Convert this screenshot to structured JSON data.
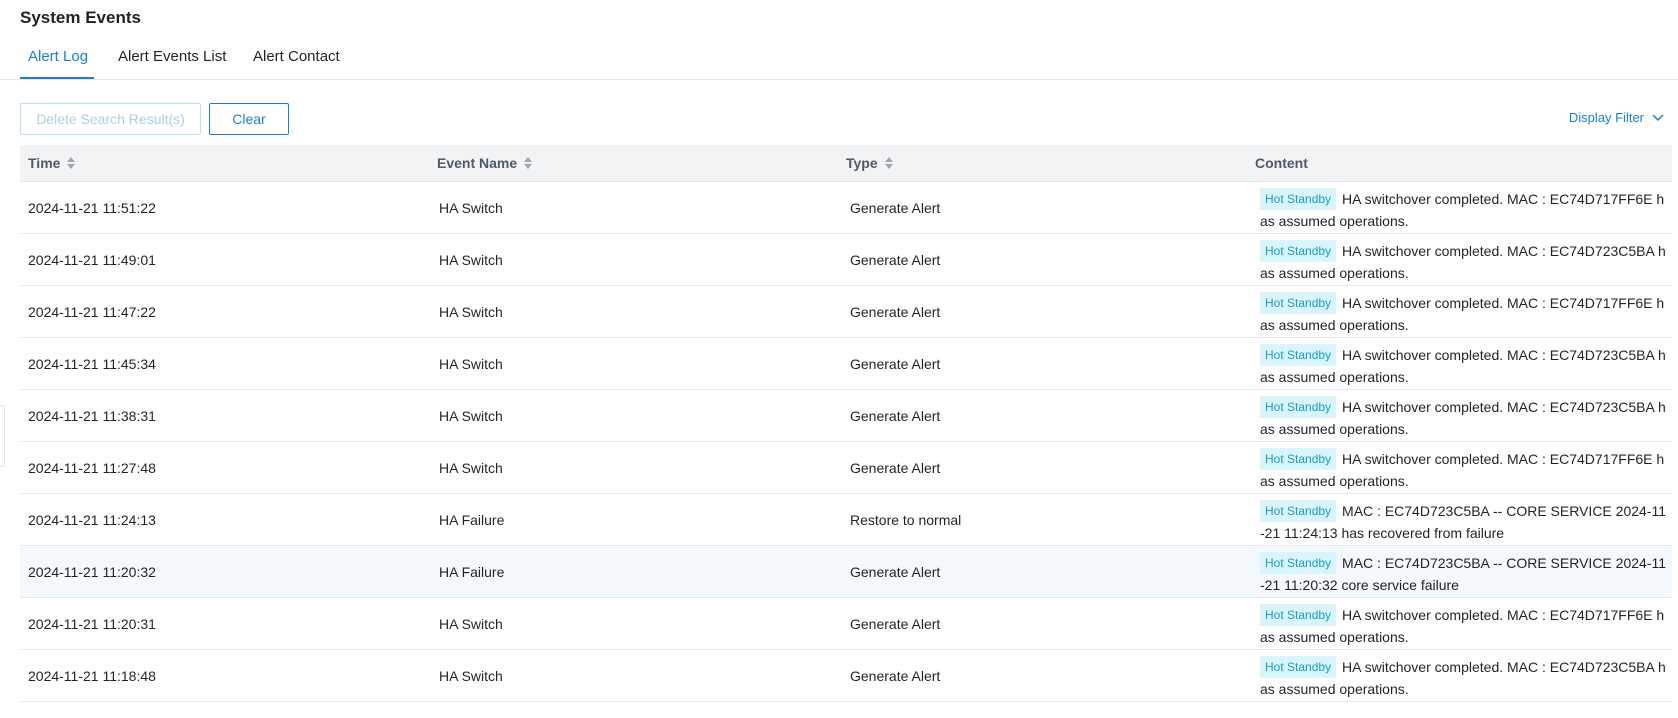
{
  "page_title": "System Events",
  "tabs": [
    {
      "label": "Alert Log",
      "active": true
    },
    {
      "label": "Alert Events List",
      "active": false
    },
    {
      "label": "Alert Contact",
      "active": false
    }
  ],
  "toolbar": {
    "delete_label": "Delete Search Result(s)",
    "clear_label": "Clear",
    "display_filter_label": "Display Filter"
  },
  "table": {
    "headers": {
      "time": "Time",
      "event_name": "Event Name",
      "type": "Type",
      "content": "Content"
    },
    "rows": [
      {
        "time": "2024-11-21 11:51:22",
        "event": "HA Switch",
        "type": "Generate Alert",
        "tag": "Hot Standby",
        "content": "HA switchover completed. MAC : EC74D717FF6E has assumed operations."
      },
      {
        "time": "2024-11-21 11:49:01",
        "event": "HA Switch",
        "type": "Generate Alert",
        "tag": "Hot Standby",
        "content": "HA switchover completed. MAC : EC74D723C5BA has assumed operations."
      },
      {
        "time": "2024-11-21 11:47:22",
        "event": "HA Switch",
        "type": "Generate Alert",
        "tag": "Hot Standby",
        "content": "HA switchover completed. MAC : EC74D717FF6E has assumed operations."
      },
      {
        "time": "2024-11-21 11:45:34",
        "event": "HA Switch",
        "type": "Generate Alert",
        "tag": "Hot Standby",
        "content": "HA switchover completed. MAC : EC74D723C5BA has assumed operations."
      },
      {
        "time": "2024-11-21 11:38:31",
        "event": "HA Switch",
        "type": "Generate Alert",
        "tag": "Hot Standby",
        "content": "HA switchover completed. MAC : EC74D723C5BA has assumed operations."
      },
      {
        "time": "2024-11-21 11:27:48",
        "event": "HA Switch",
        "type": "Generate Alert",
        "tag": "Hot Standby",
        "content": "HA switchover completed. MAC : EC74D717FF6E has assumed operations."
      },
      {
        "time": "2024-11-21 11:24:13",
        "event": "HA Failure",
        "type": "Restore to normal",
        "tag": "Hot Standby",
        "content": "MAC : EC74D723C5BA -- CORE SERVICE 2024-11-21 11:24:13 has recovered from failure"
      },
      {
        "time": "2024-11-21 11:20:32",
        "event": "HA Failure",
        "type": "Generate Alert",
        "tag": "Hot Standby",
        "content": "MAC : EC74D723C5BA -- CORE SERVICE 2024-11-21 11:20:32 core service failure"
      },
      {
        "time": "2024-11-21 11:20:31",
        "event": "HA Switch",
        "type": "Generate Alert",
        "tag": "Hot Standby",
        "content": "HA switchover completed. MAC : EC74D717FF6E has assumed operations."
      },
      {
        "time": "2024-11-21 11:18:48",
        "event": "HA Switch",
        "type": "Generate Alert",
        "tag": "Hot Standby",
        "content": "HA switchover completed. MAC : EC74D723C5BA has assumed operations."
      }
    ]
  },
  "icons": {
    "sort": "sort-icon",
    "chevron": "chevron-down-icon"
  },
  "colors": {
    "accent": "#1a7fd4",
    "tag_bg": "#d9f5fb",
    "tag_text": "#1a9cc4",
    "highlight_row": "#f3f8fc"
  }
}
